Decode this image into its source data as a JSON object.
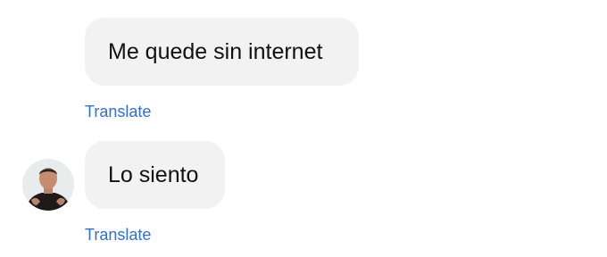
{
  "messages": [
    {
      "text": "Me quede sin internet",
      "translate_label": "Translate"
    },
    {
      "text": "Lo siento",
      "translate_label": "Translate"
    }
  ],
  "colors": {
    "bubble_bg": "#f2f2f2",
    "link": "#2f6fd6",
    "text": "#111111"
  },
  "icons": {
    "avatar": "user-photo-avatar"
  }
}
